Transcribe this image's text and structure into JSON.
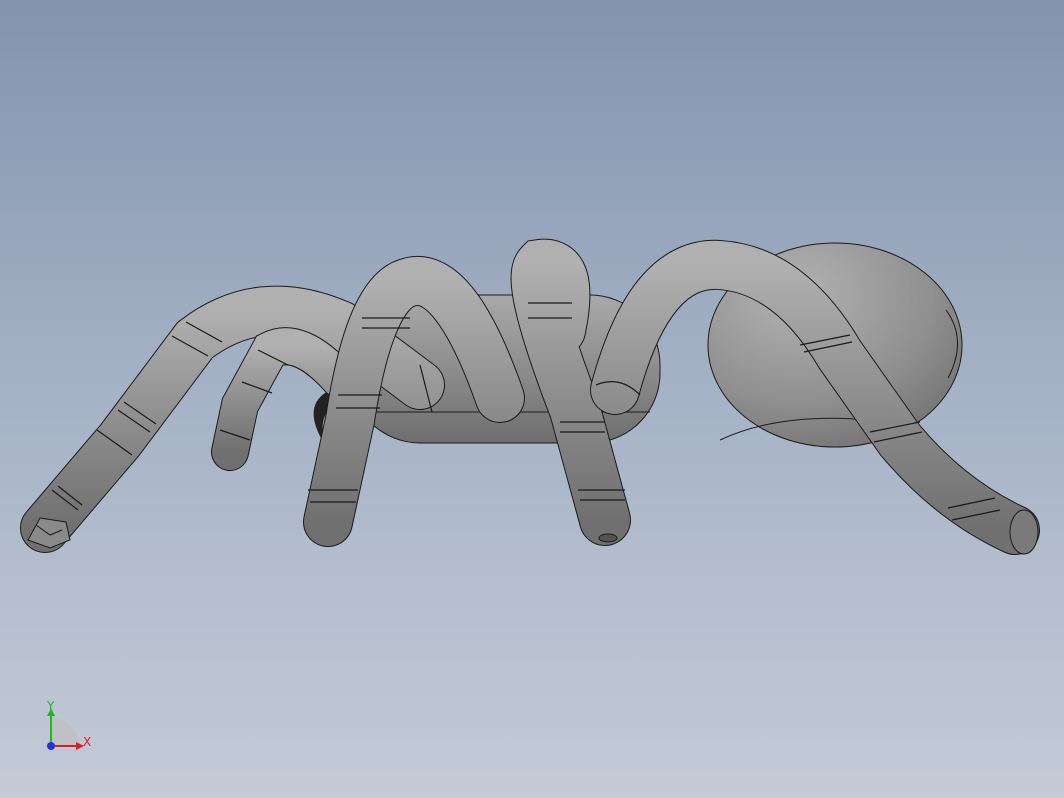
{
  "viewport": {
    "background_top": "#8294ae",
    "background_bottom": "#c4cbd7",
    "model_shade": "#8d8d8d",
    "edge_color": "#1a1a1a"
  },
  "triad": {
    "y_label": "Y",
    "x_label": "X",
    "y_color": "#1fb81f",
    "x_color": "#e01e1e",
    "z_color": "#2233dd"
  }
}
